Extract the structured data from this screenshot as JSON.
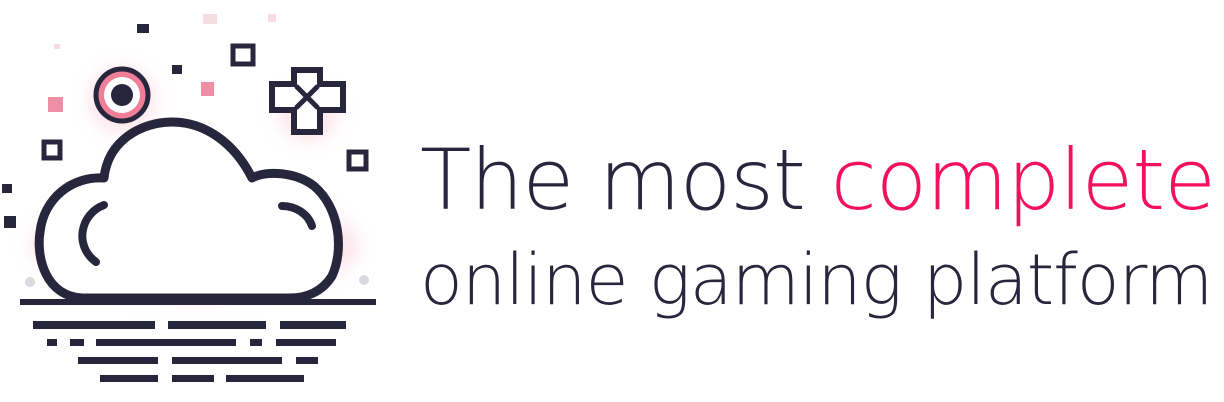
{
  "tagline": {
    "line1_prefix": "The most ",
    "line1_accent": "complete",
    "line2": "online gaming platform"
  },
  "colors": {
    "dark": "#28263d",
    "accent": "#f5105b",
    "pink_soft": "#ef8fa6",
    "glow": "#fde6eb"
  },
  "icons": {
    "logo": "cloud-gaming-icon",
    "ring": "circle-button-icon",
    "dpad": "dpad-cross-icon",
    "base": "ground-lines-icon"
  }
}
